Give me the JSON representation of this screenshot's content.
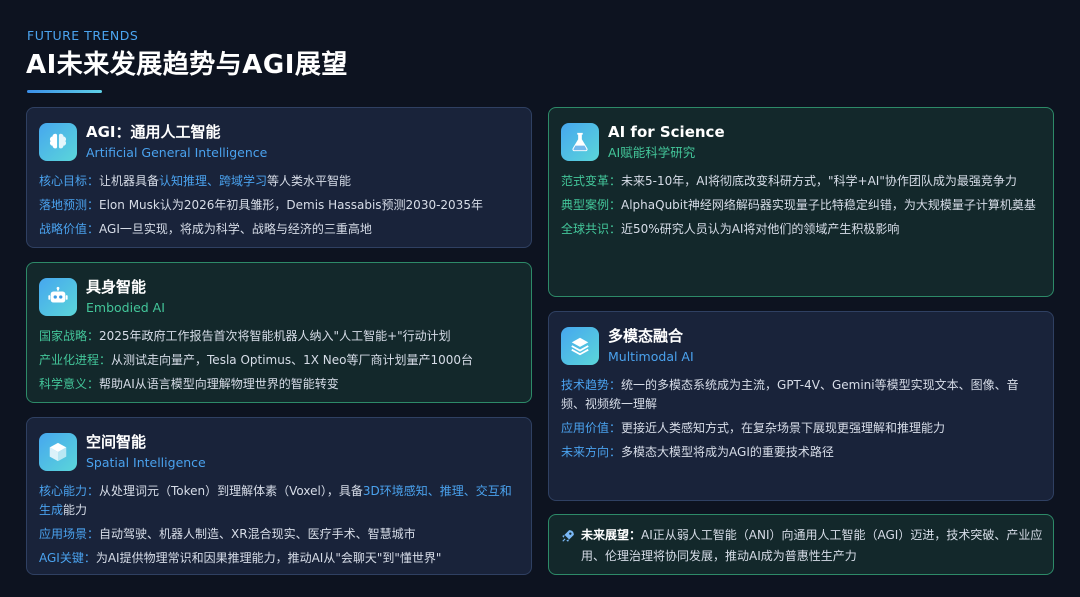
{
  "header": {
    "eyebrow": "FUTURE TRENDS",
    "title": "AI未来发展趋势与AGI展望"
  },
  "colors": {
    "background": "#0d1320",
    "accent_blue": "#4aa2ee",
    "accent_green": "#43c69a",
    "card_blue": "#19233a",
    "card_green": "#13282b"
  },
  "cards": {
    "agi": {
      "icon": "brain-icon",
      "title": "AGI：通用人工智能",
      "subtitle": "Artificial General Intelligence",
      "rows": [
        {
          "label": "核心目标：",
          "pre": "让机器具备",
          "highlight": "认知推理、跨域学习",
          "post": "等人类水平智能"
        },
        {
          "label": "落地预测：",
          "text": "Elon Musk认为2026年初具雏形，Demis Hassabis预测2030-2035年"
        },
        {
          "label": "战略价值：",
          "text": "AGI一旦实现，将成为科学、战略与经济的三重高地"
        }
      ]
    },
    "embodied": {
      "icon": "robot-icon",
      "title": "具身智能",
      "subtitle": "Embodied AI",
      "rows": [
        {
          "label": "国家战略：",
          "text": "2025年政府工作报告首次将智能机器人纳入\"人工智能+\"行动计划"
        },
        {
          "label": "产业化进程：",
          "text": "从测试走向量产，Tesla Optimus、1X Neo等厂商计划量产1000台"
        },
        {
          "label": "科学意义：",
          "text": "帮助AI从语言模型向理解物理世界的智能转变"
        }
      ]
    },
    "spatial": {
      "icon": "cube-icon",
      "title": "空间智能",
      "subtitle": "Spatial Intelligence",
      "rows": [
        {
          "label": "核心能力：",
          "pre": "从处理词元（Token）到理解体素（Voxel），具备",
          "highlight": "3D环境感知、推理、交互和生成",
          "post": "能力"
        },
        {
          "label": "应用场景：",
          "text": "自动驾驶、机器人制造、XR混合现实、医疗手术、智慧城市"
        },
        {
          "label": "AGI关键：",
          "text": "为AI提供物理常识和因果推理能力，推动AI从\"会聊天\"到\"懂世界\""
        }
      ]
    },
    "science": {
      "icon": "flask-icon",
      "title": "AI for Science",
      "subtitle": "AI赋能科学研究",
      "rows": [
        {
          "label": "范式变革：",
          "text": "未来5-10年，AI将彻底改变科研方式，\"科学+AI\"协作团队成为最强竞争力"
        },
        {
          "label": "典型案例：",
          "text": "AlphaQubit神经网络解码器实现量子比特稳定纠错，为大规模量子计算机奠基"
        },
        {
          "label": "全球共识：",
          "text": "近50%研究人员认为AI将对他们的领域产生积极影响"
        }
      ]
    },
    "multimodal": {
      "icon": "layers-icon",
      "title": "多模态融合",
      "subtitle": "Multimodal AI",
      "rows": [
        {
          "label": "技术趋势：",
          "text": "统一的多模态系统成为主流，GPT-4V、Gemini等模型实现文本、图像、音频、视频统一理解"
        },
        {
          "label": "应用价值：",
          "text": "更接近人类感知方式，在复杂场景下展现更强理解和推理能力"
        },
        {
          "label": "未来方向：",
          "text": "多模态大模型将成为AGI的重要技术路径"
        }
      ]
    }
  },
  "footer": {
    "icon": "rocket-icon",
    "label": "未来展望：",
    "text": "AI正从弱人工智能（ANI）向通用人工智能（AGI）迈进，技术突破、产业应用、伦理治理将协同发展，推动AI成为普惠性生产力"
  }
}
